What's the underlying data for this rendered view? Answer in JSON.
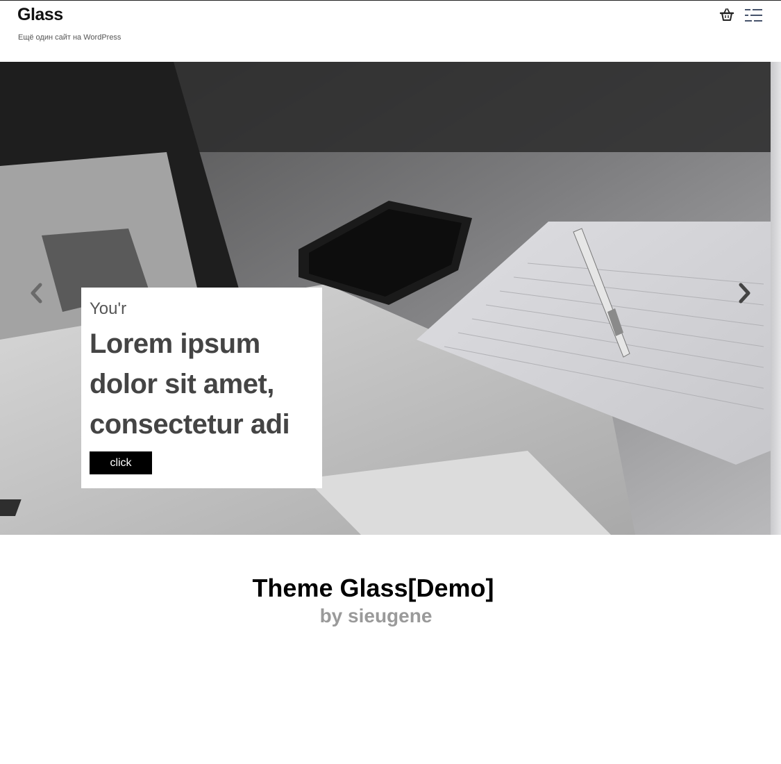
{
  "header": {
    "site_title": "Glass",
    "tagline": "Ещё один сайт на WordPress",
    "icons": {
      "cart": "basket-icon",
      "menu": "menu-icon"
    }
  },
  "slider": {
    "caption_small": "You'r",
    "caption_big_lines": [
      "Lorem ipsum",
      "dolor sit amet,",
      "consectetur adi"
    ],
    "button_label": "click",
    "icons": {
      "prev": "chevron-left-icon",
      "next": "chevron-right-icon"
    }
  },
  "main": {
    "title": "Theme Glass[Demo]",
    "author": "by sieugene"
  },
  "colors": {
    "button_bg": "#000000",
    "author_text": "#9a9a9a",
    "caption_text": "#444444"
  }
}
